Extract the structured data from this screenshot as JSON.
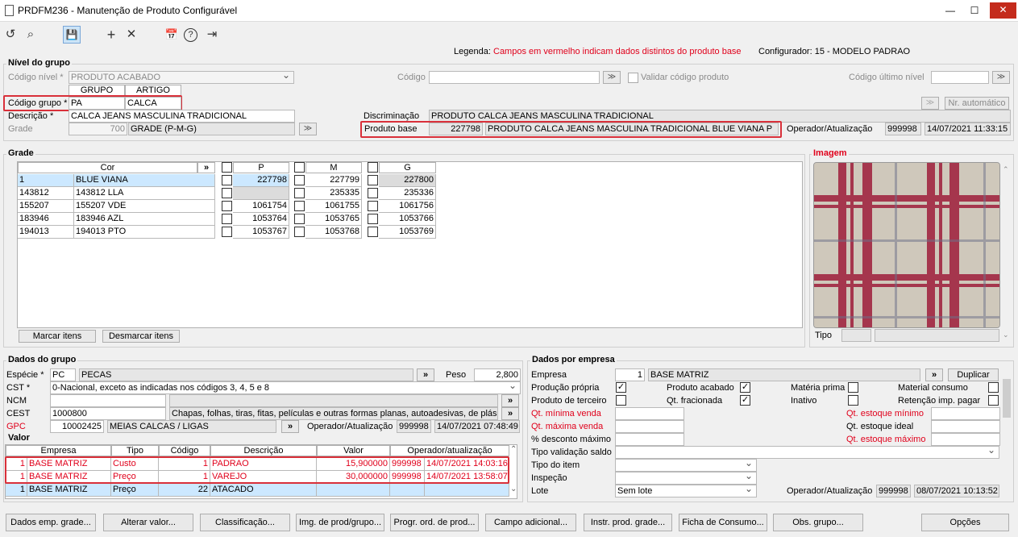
{
  "window": {
    "title": "PRDFM236 - Manutenção de Produto Configurável",
    "minimize": "—",
    "maximize": "☐",
    "close": "✕"
  },
  "toolbar": {
    "icons": [
      "undo-icon",
      "search-icon",
      "save-icon",
      "add-icon",
      "close-icon",
      "calendar-icon",
      "help-icon",
      "exit-icon"
    ],
    "undo": "↺",
    "search": "⌕",
    "save": "💾",
    "add": "+",
    "cancel": "✕",
    "calendar": "📅",
    "help": "?",
    "exit": "⇥"
  },
  "legend": {
    "label": "Legenda:",
    "text": "Campos em vermelho indicam dados distintos do produto base",
    "configurador": "Configurador: 15 - MODELO PADRAO"
  },
  "nivel": {
    "title": "Nível do grupo",
    "codigo_nivel_label": "Código nível *",
    "codigo_nivel_value": "PRODUTO ACABADO",
    "codigo_label": "Código",
    "validar_label": "Validar código produto",
    "codigo_ultimo_label": "Código último nível",
    "grupo_hdr": "GRUPO",
    "artigo_hdr": "ARTIGO",
    "codigo_grupo_label": "Código grupo *",
    "grupo": "PA",
    "artigo": "CALCA",
    "descricao_label": "Descrição *",
    "descricao": "CALCA JEANS MASCULINA TRADICIONAL",
    "grade_label": "Grade",
    "grade_num": "700",
    "grade_text": "GRADE (P-M-G)",
    "discriminacao_label": "Discriminação",
    "discriminacao": "PRODUTO CALCA JEANS MASCULINA TRADICIONAL",
    "produto_base_label": "Produto base",
    "produto_base_num": "227798",
    "produto_base_text": "PRODUTO CALCA JEANS MASCULINA TRADICIONAL BLUE VIANA P",
    "operador_label": "Operador/Atualização",
    "operador": "999998",
    "data": "14/07/2021 11:33:15",
    "nr_auto": "Nr. automático"
  },
  "grade": {
    "title": "Grade",
    "cor_hdr": "Cor",
    "more": "»",
    "sizes": [
      "P",
      "M",
      "G"
    ],
    "rows": [
      {
        "code": "1",
        "name": "BLUE VIANA",
        "p": "227798",
        "m": "227799",
        "g": "227800"
      },
      {
        "code": "143812",
        "name": "143812 LLA",
        "p": "",
        "m": "235335",
        "g": "235336"
      },
      {
        "code": "155207",
        "name": "155207 VDE",
        "p": "1061754",
        "m": "1061755",
        "g": "1061756"
      },
      {
        "code": "183946",
        "name": "183946 AZL",
        "p": "1053764",
        "m": "1053765",
        "g": "1053766"
      },
      {
        "code": "194013",
        "name": "194013 PTO",
        "p": "1053767",
        "m": "1053768",
        "g": "1053769"
      }
    ],
    "marcar": "Marcar itens",
    "desmarcar": "Desmarcar itens"
  },
  "imagem": {
    "title": "Imagem",
    "tipo_label": "Tipo"
  },
  "dados_grupo": {
    "title": "Dados do grupo",
    "especie_label": "Espécie *",
    "especie_code": "PC",
    "especie_text": "PECAS",
    "peso_label": "Peso",
    "peso": "2,800",
    "cst_label": "CST *",
    "cst": "0-Nacional, exceto as indicadas nos códigos 3, 4, 5 e 8",
    "ncm_label": "NCM",
    "cest_label": "CEST",
    "cest": "1000800",
    "cest_text": "Chapas, folhas, tiras, fitas, películas e outras formas planas, autoadesivas, de plás",
    "gpc_label": "GPC",
    "gpc_code": "10002425",
    "gpc_text": "MEIAS CALCAS / LIGAS",
    "operador_label": "Operador/Atualização",
    "operador": "999998",
    "data": "14/07/2021 07:48:49"
  },
  "valor": {
    "title": "Valor",
    "headers": [
      "Empresa",
      "Tipo",
      "Código",
      "Descrição",
      "Valor",
      "Operador/atualização"
    ],
    "rows": [
      {
        "n": "1",
        "empresa": "BASE MATRIZ",
        "tipo": "Custo",
        "codigo": "1",
        "descricao": "PADRAO",
        "valor": "15,900000",
        "op": "999998",
        "data": "14/07/2021 14:03:16"
      },
      {
        "n": "1",
        "empresa": "BASE MATRIZ",
        "tipo": "Preço",
        "codigo": "1",
        "descricao": "VAREJO",
        "valor": "30,000000",
        "op": "999998",
        "data": "14/07/2021 13:58:07"
      },
      {
        "n": "1",
        "empresa": "BASE MATRIZ",
        "tipo": "Preço",
        "codigo": "22",
        "descricao": "ATACADO",
        "valor": "",
        "op": "",
        "data": ""
      }
    ]
  },
  "empresa": {
    "title": "Dados por empresa",
    "empresa_label": "Empresa",
    "empresa_num": "1",
    "empresa_text": "BASE MATRIZ",
    "duplicar": "Duplicar",
    "producao_propria": "Produção própria",
    "produto_acabado": "Produto acabado",
    "materia_prima": "Matéria prima",
    "material_consumo": "Material consumo",
    "produto_terceiro": "Produto de terceiro",
    "qt_fracionada": "Qt. fracionada",
    "inativo": "Inativo",
    "retencao": "Retenção imp. pagar",
    "qt_min_venda": "Qt. mínima venda",
    "qt_max_venda": "Qt. máxima venda",
    "pct_desconto": "% desconto máximo",
    "qt_est_min": "Qt. estoque mínimo",
    "qt_est_ideal": "Qt. estoque ideal",
    "qt_est_max": "Qt. estoque máximo",
    "tipo_validacao": "Tipo validação saldo",
    "tipo_item": "Tipo do item",
    "inspecao": "Inspeção",
    "lote": "Lote",
    "lote_value": "Sem lote",
    "operador_label": "Operador/Atualização",
    "operador": "999998",
    "data": "08/07/2021 10:13:52"
  },
  "bottom": [
    "Dados emp. grade...",
    "Alterar valor...",
    "Classificação...",
    "Img. de prod/grupo...",
    "Progr. ord. de prod...",
    "Campo adicional...",
    "Instr. prod. grade...",
    "Ficha de Consumo...",
    "Obs. grupo...",
    "Opções"
  ],
  "colors": {
    "red": "#e0001b",
    "highlight": "#d9303a",
    "selected": "#cce8ff"
  }
}
